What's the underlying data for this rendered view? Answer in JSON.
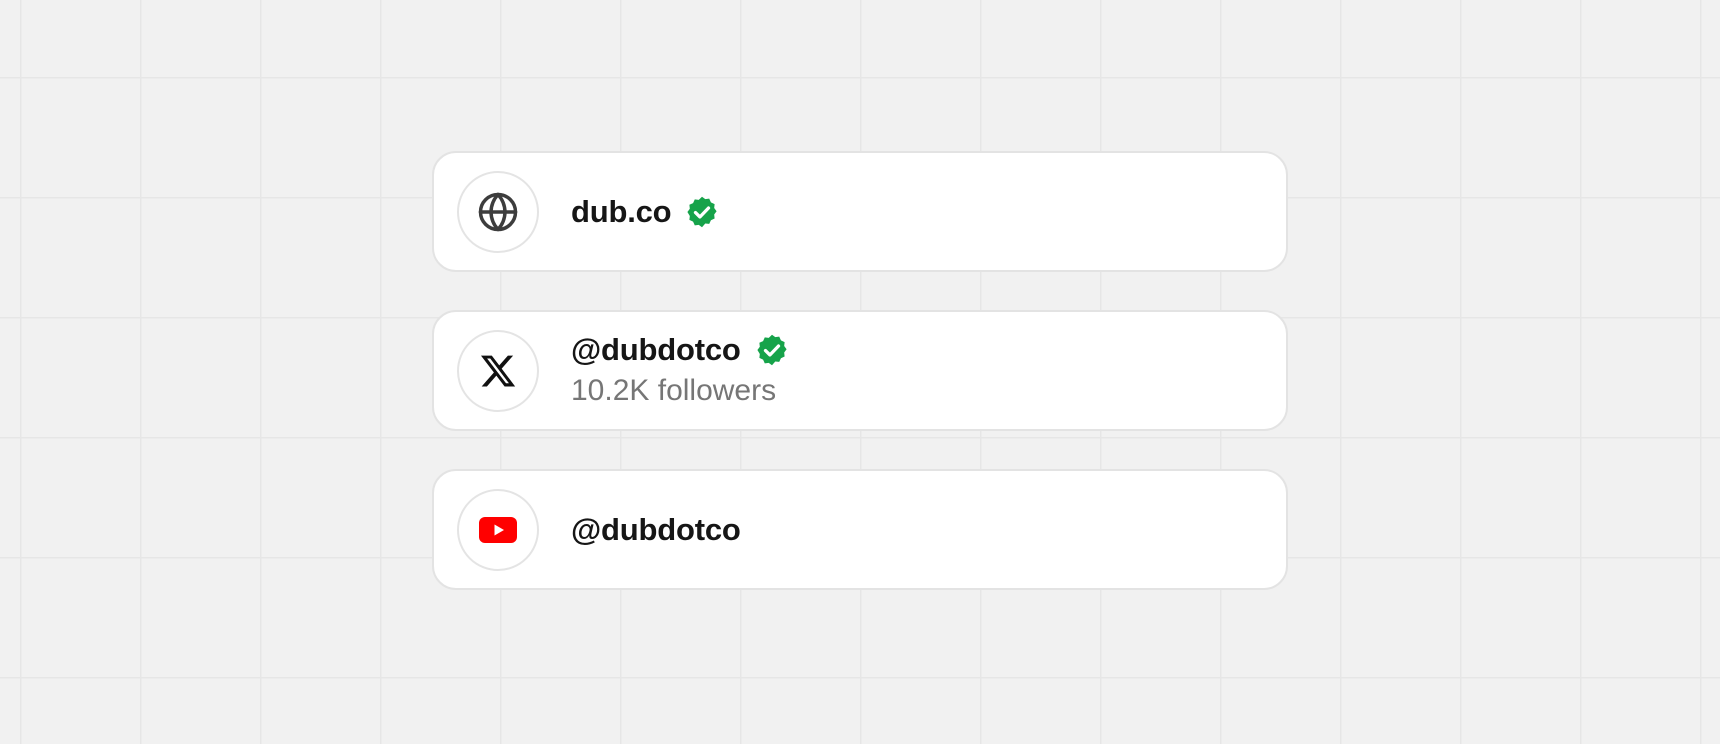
{
  "colors": {
    "background": "#f1f1f1",
    "card": "#ffffff",
    "card_border": "#e3e3e3",
    "verified": "#16a34a",
    "youtube": "#ff0000"
  },
  "cards": [
    {
      "icon": "globe-icon",
      "title": "dub.co",
      "verified": true
    },
    {
      "icon": "x-logo-icon",
      "title": "@dubdotco",
      "verified": true,
      "subtitle": "10.2K followers"
    },
    {
      "icon": "youtube-logo-icon",
      "title": "@dubdotco",
      "verified": false
    }
  ]
}
